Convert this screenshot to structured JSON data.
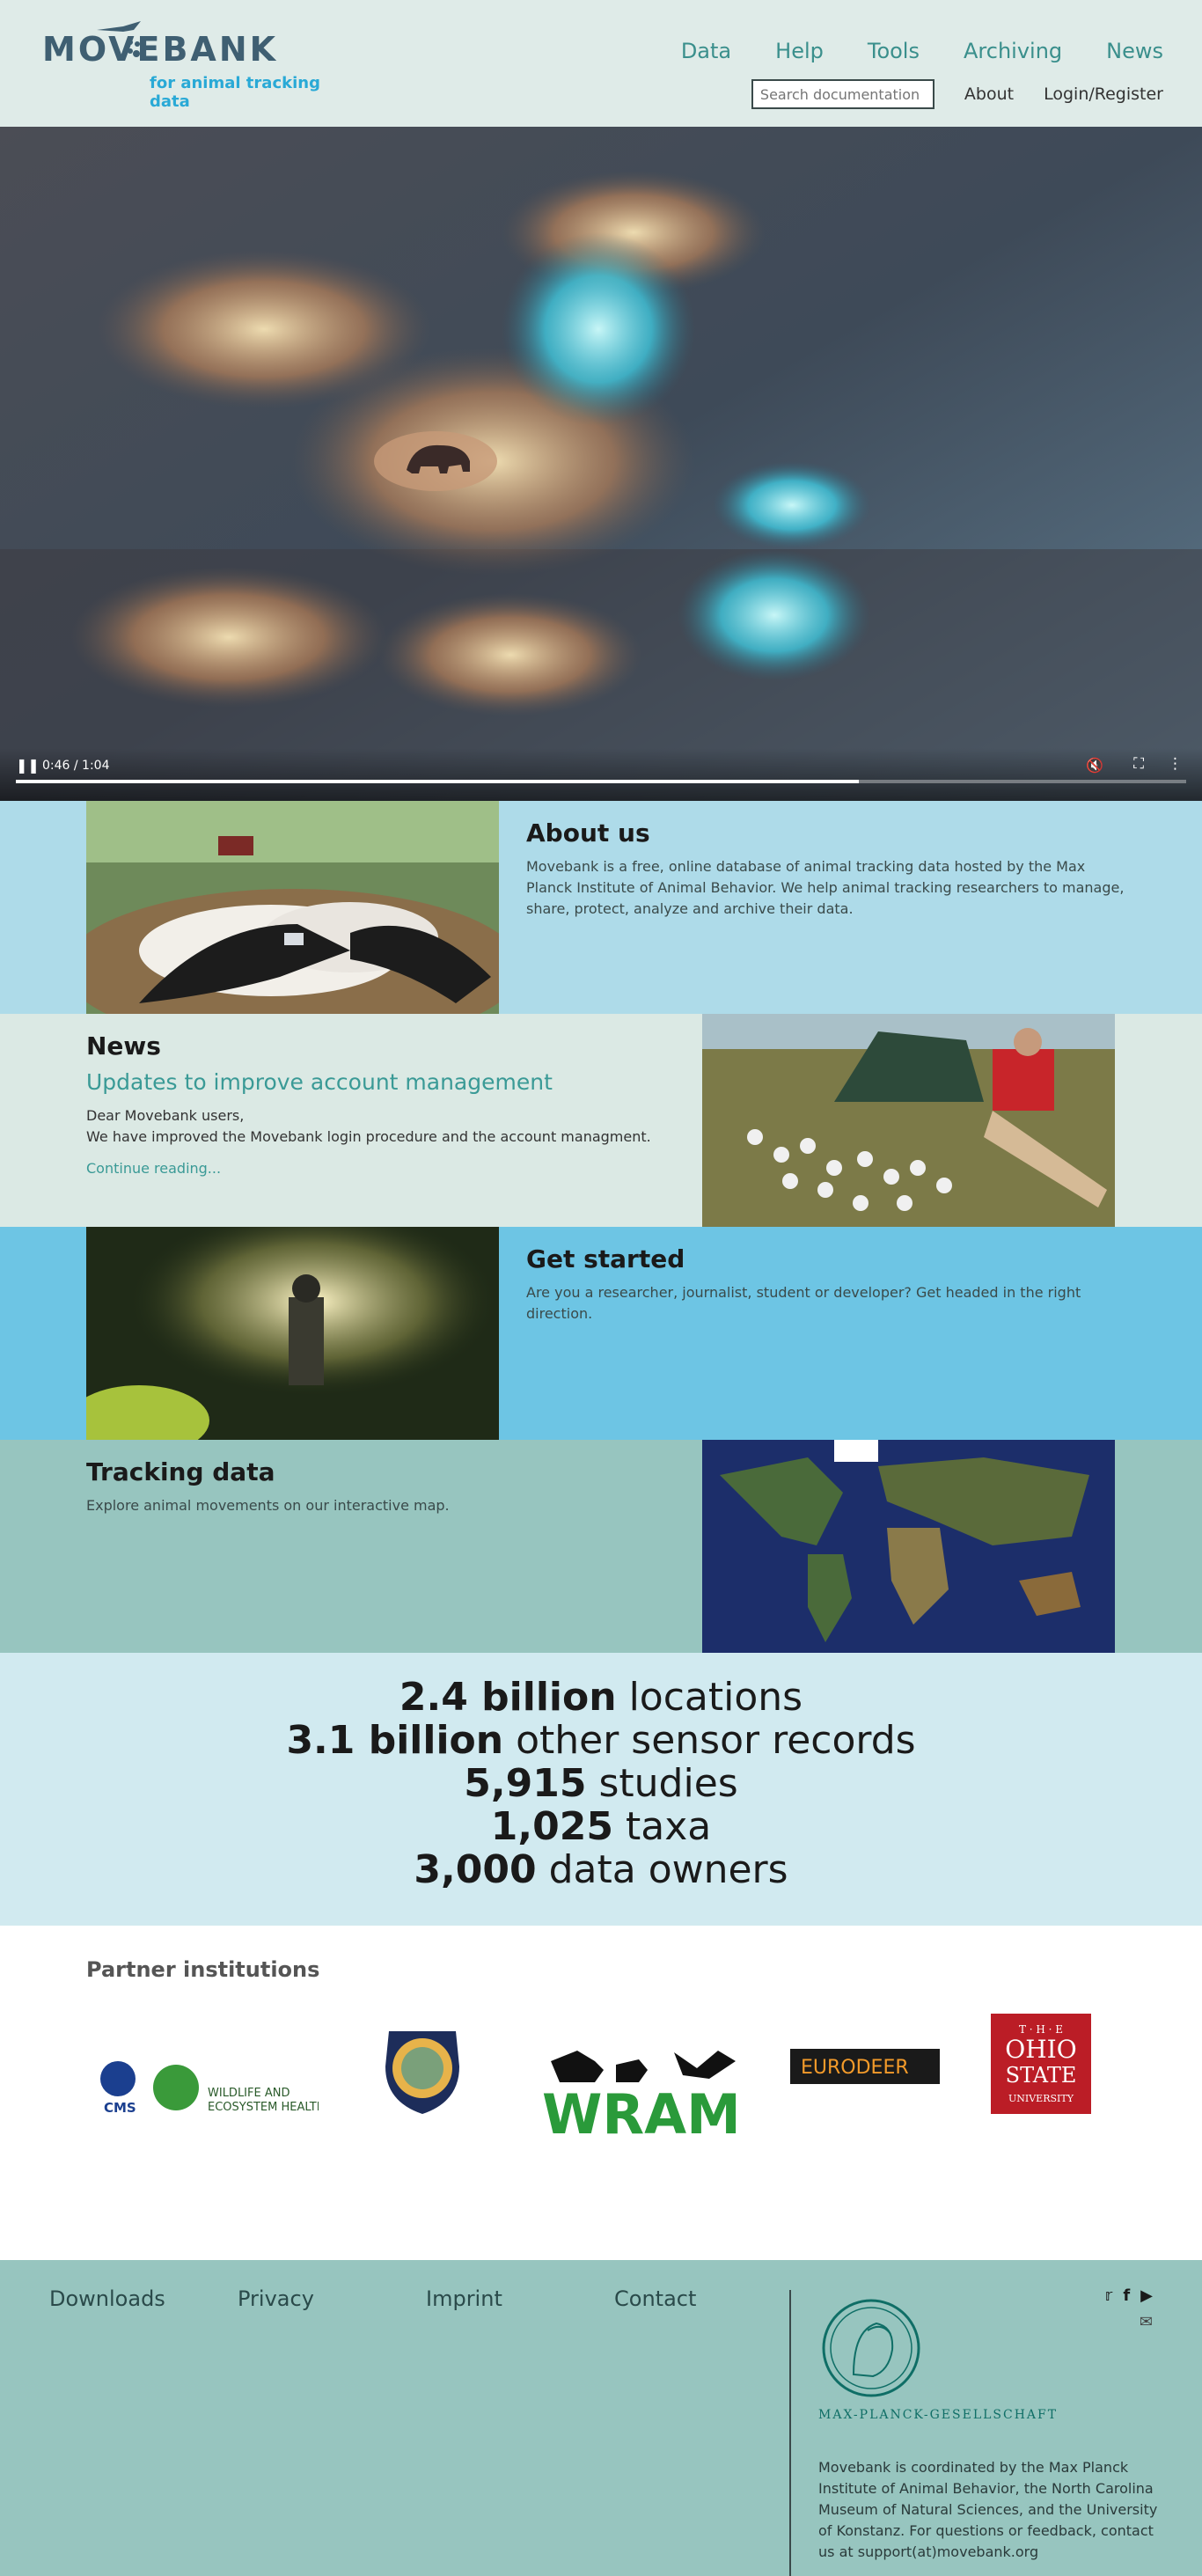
{
  "header": {
    "logo_text": "MOVEBANK",
    "tagline": "for animal tracking data",
    "nav": [
      "Data",
      "Help",
      "Tools",
      "Archiving",
      "News"
    ],
    "search_placeholder": "Search documentation",
    "about": "About",
    "login": "Login/Register"
  },
  "video": {
    "time": "0:46 / 1:04",
    "progress": 0.72
  },
  "about": {
    "title": "About us",
    "text": "Movebank is a free, online database of animal tracking data hosted by the Max Planck Institute of Animal Behavior. We help animal tracking researchers to manage, share, protect, analyze and archive their data."
  },
  "news": {
    "title": "News",
    "headline": "Updates to improve account management",
    "line1": "Dear Movebank users,",
    "line2": "We have improved the Movebank login procedure and the account managment.",
    "more": "Continue reading..."
  },
  "get_started": {
    "title": "Get started",
    "text": "Are you a researcher, journalist, student or developer? Get headed in the right direction."
  },
  "tracking": {
    "title": "Tracking data",
    "text": "Explore animal movements on our interactive map."
  },
  "stats": [
    {
      "value": "2.4 billion",
      "label": "locations"
    },
    {
      "value": "3.1 billion",
      "label": "other sensor records"
    },
    {
      "value": "5,915",
      "label": "studies"
    },
    {
      "value": "1,025",
      "label": "taxa"
    },
    {
      "value": "3,000",
      "label": "data owners"
    }
  ],
  "partners": {
    "title": "Partner institutions",
    "cms": "CMS",
    "wildlife_1": "WILDLIFE AND",
    "wildlife_2": "ECOSYSTEM HEALTH",
    "wram": "WRAM",
    "eurodeer": "EURODEER",
    "ohio_1": "T · H · E",
    "ohio_2": "OHIO",
    "ohio_3": "STATE",
    "ohio_4": "UNIVERSITY"
  },
  "footer": {
    "links": [
      "Downloads",
      "Privacy",
      "Imprint",
      "Contact"
    ],
    "mpg": "MAX-PLANCK-GESELLSCHAFT",
    "about": "Movebank is coordinated by the Max Planck Institute of Animal Behavior, the North Carolina Museum of Natural Sciences, and the University of Konstanz. For questions or feedback, contact us at support(at)movebank.org"
  },
  "colors": {
    "header_bg": "#dfebe8",
    "accent": "#3a8f8c",
    "about_bg": "#aedbe9",
    "news_bg": "#dbe9e4",
    "start_bg": "#6dc5e4",
    "tracking_bg": "#97c5bf",
    "stats_bg": "#d1eaf0",
    "footer_bg": "#97c5bf"
  }
}
